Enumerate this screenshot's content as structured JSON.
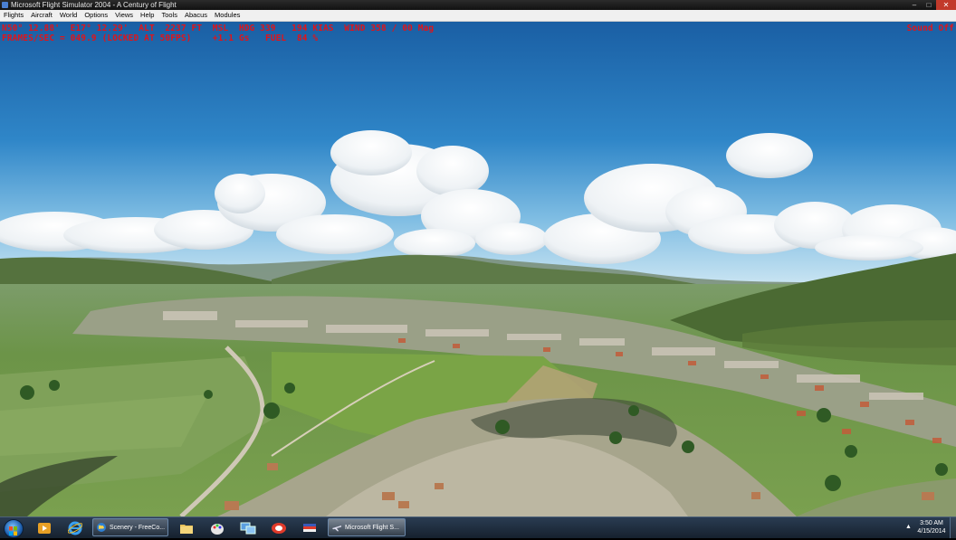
{
  "window": {
    "title": "Microsoft Flight Simulator 2004 - A Century of Flight",
    "controls": {
      "minimize": "–",
      "maximize": "□",
      "close": "✕"
    }
  },
  "menu": [
    "Flights",
    "Aircraft",
    "World",
    "Options",
    "Views",
    "Help",
    "Tools",
    "Abacus",
    "Modules"
  ],
  "hud": {
    "line1": "N50° 12.88'  E17° 12.29'  ALT  2237 FT  MSL  HDG 339   194 KIAS  WIND 358 / 00 Mag",
    "line2": "FRAMES/SEC = 049.9 (LOCKED AT 50FPS)    +1.1 Gs   FUEL  84 %",
    "sound": "Sound Off",
    "color": "#e0141a"
  },
  "taskbar": {
    "pinned": [
      "start-orb",
      "media-player-icon",
      "internet-explorer-icon",
      "folder-icon",
      "paint-icon",
      "network-icon",
      "game-icon",
      "flag-icon"
    ],
    "tasks": [
      {
        "label": "Scenery - FreeCo...",
        "icon": "globe-icon"
      },
      {
        "label": "Microsoft Flight S...",
        "icon": "airplane-icon"
      }
    ],
    "tray_arrow": "▲",
    "clock": {
      "time": "3:50 AM",
      "date": "4/15/2014"
    }
  },
  "colors": {
    "sky_top": "#1f6bb0",
    "sky_horizon": "#a9d3ec",
    "grass": "#6f9a48",
    "taskbar": "#1e2d3f"
  }
}
